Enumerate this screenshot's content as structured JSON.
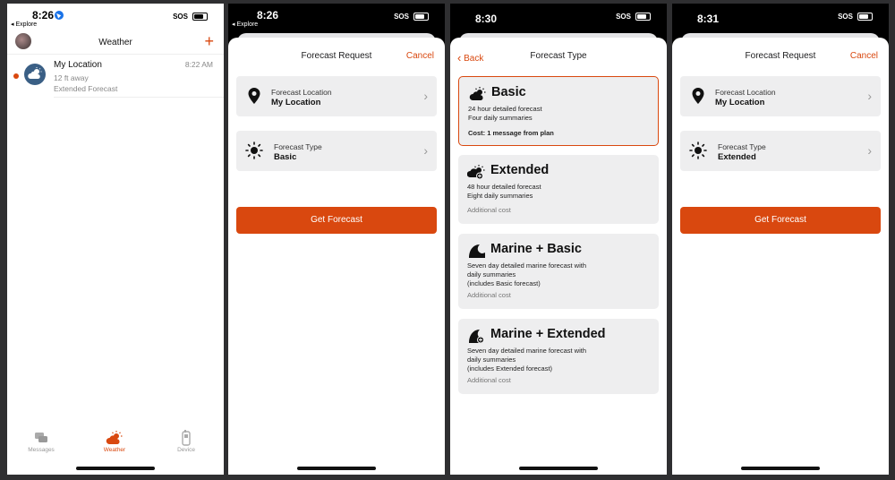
{
  "phone1": {
    "status": {
      "time": "8:26",
      "back": "◂ Explore",
      "sos": "SOS"
    },
    "header": {
      "title": "Weather",
      "add": "+"
    },
    "message": {
      "name": "My Location",
      "time": "8:22 AM",
      "distance": "12 ft away",
      "subtitle": "Extended Forecast"
    },
    "tabs": [
      {
        "label": "Messages",
        "icon": "messages-icon"
      },
      {
        "label": "Weather",
        "icon": "weather-icon"
      },
      {
        "label": "Device",
        "icon": "device-icon"
      }
    ],
    "accent": "#d9480f"
  },
  "phone2": {
    "status": {
      "time": "8:26",
      "back": "◂ Explore",
      "sos": "SOS"
    },
    "title": "Forecast Request",
    "cancel": "Cancel",
    "location": {
      "label": "Forecast Location",
      "value": "My Location"
    },
    "type": {
      "label": "Forecast Type",
      "value": "Basic"
    },
    "button": "Get Forecast"
  },
  "phone3": {
    "status": {
      "time": "8:30",
      "sos": "SOS"
    },
    "back": "Back",
    "title": "Forecast Type",
    "options": [
      {
        "title": "Basic",
        "line1": "24 hour detailed forecast",
        "line2": "Four daily summaries",
        "line3": "",
        "cost": "Cost: 1 message from plan",
        "selected": true
      },
      {
        "title": "Extended",
        "line1": "48 hour detailed forecast",
        "line2": "Eight daily summaries",
        "line3": "",
        "cost": "Additional cost",
        "selected": false
      },
      {
        "title": "Marine + Basic",
        "line1": "Seven day detailed marine forecast with",
        "line2": "daily summaries",
        "line3": "(includes Basic forecast)",
        "cost": "Additional cost",
        "selected": false
      },
      {
        "title": "Marine + Extended",
        "line1": "Seven day detailed marine forecast with",
        "line2": "daily summaries",
        "line3": "(includes Extended forecast)",
        "cost": "Additional cost",
        "selected": false
      }
    ]
  },
  "phone4": {
    "status": {
      "time": "8:31",
      "sos": "SOS"
    },
    "title": "Forecast Request",
    "cancel": "Cancel",
    "location": {
      "label": "Forecast Location",
      "value": "My Location"
    },
    "type": {
      "label": "Forecast Type",
      "value": "Extended"
    },
    "button": "Get Forecast"
  }
}
